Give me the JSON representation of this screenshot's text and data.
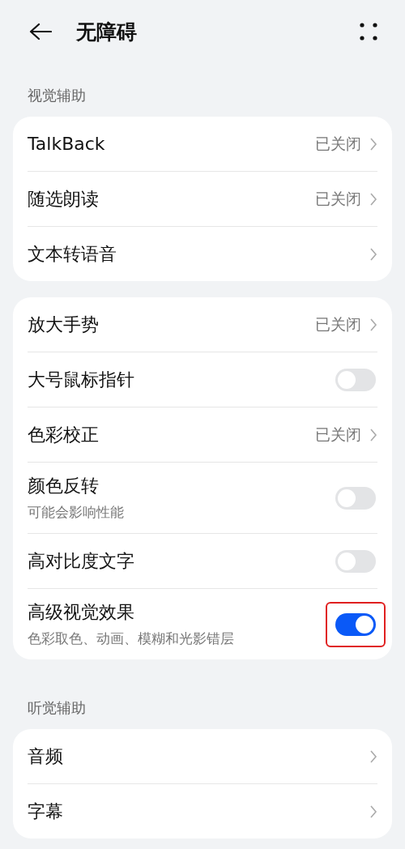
{
  "header": {
    "title": "无障碍"
  },
  "sections": [
    {
      "label": "视觉辅助",
      "groups": [
        [
          {
            "kind": "link",
            "label": "TalkBack",
            "value": "已关闭"
          },
          {
            "kind": "link",
            "label": "随选朗读",
            "value": "已关闭"
          },
          {
            "kind": "link",
            "label": "文本转语音"
          }
        ],
        [
          {
            "kind": "link",
            "label": "放大手势",
            "value": "已关闭"
          },
          {
            "kind": "toggle",
            "label": "大号鼠标指针",
            "on": false
          },
          {
            "kind": "link",
            "label": "色彩校正",
            "value": "已关闭"
          },
          {
            "kind": "toggle",
            "label": "颜色反转",
            "subtitle": "可能会影响性能",
            "on": false
          },
          {
            "kind": "toggle",
            "label": "高对比度文字",
            "on": false
          },
          {
            "kind": "toggle",
            "label": "高级视觉效果",
            "subtitle": "色彩取色、动画、模糊和光影错层",
            "on": true,
            "highlighted": true
          }
        ]
      ]
    },
    {
      "label": "听觉辅助",
      "groups": [
        [
          {
            "kind": "link",
            "label": "音频"
          },
          {
            "kind": "link",
            "label": "字幕"
          }
        ]
      ]
    }
  ]
}
